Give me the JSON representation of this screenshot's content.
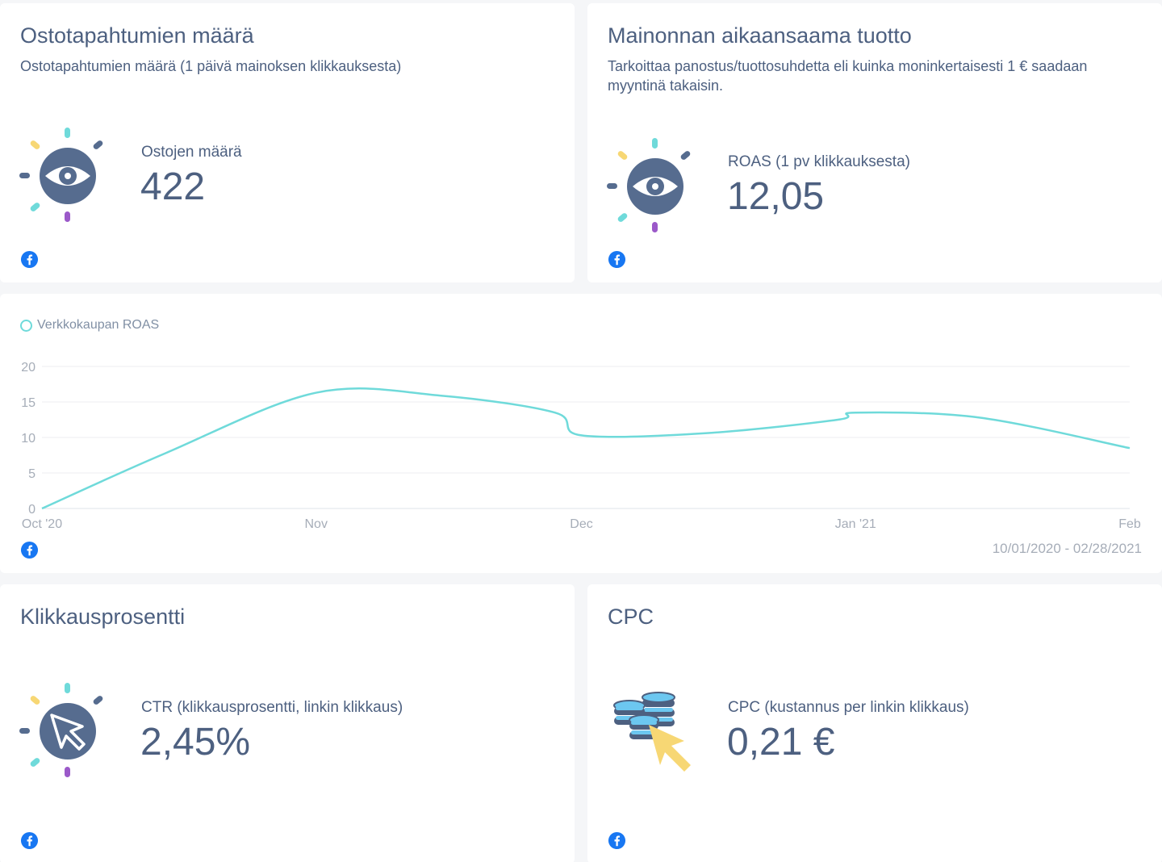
{
  "cards": {
    "purchases": {
      "title": "Ostotapahtumien määrä",
      "subtitle": "Ostotapahtumien määrä (1 päivä mainoksen klikkauksesta)",
      "metric_label": "Ostojen määrä",
      "metric_value": "422",
      "icon": "eye-icon",
      "source_icon": "facebook-icon"
    },
    "roas": {
      "title": "Mainonnan aikaansaama tuotto",
      "subtitle": "Tarkoittaa panostus/tuottosuhdetta eli kuinka moninkertaisesti 1 € saadaan myyntinä takaisin.",
      "metric_label": "ROAS (1 pv klikkauksesta)",
      "metric_value": "12,05",
      "icon": "eye-icon",
      "source_icon": "facebook-icon"
    },
    "ctr": {
      "title": "Klikkausprosentti",
      "metric_label": "CTR (klikkausprosentti, linkin klikkaus)",
      "metric_value": "2,45%",
      "icon": "cursor-click-icon",
      "source_icon": "facebook-icon"
    },
    "cpc": {
      "title": "CPC",
      "metric_label": "CPC (kustannus per linkin klikkaus)",
      "metric_value": "0,21 €",
      "icon": "coins-cursor-icon",
      "source_icon": "facebook-icon"
    }
  },
  "chart_card": {
    "date_range": "10/01/2020 - 02/28/2021",
    "source_icon": "facebook-icon"
  },
  "colors": {
    "text": "#4d6080",
    "line": "#6fdada",
    "icon_dark": "#566c8f",
    "spark_yellow": "#f7d774",
    "spark_teal": "#6fdada",
    "spark_purple": "#9b59c9",
    "facebook": "#1877f2"
  },
  "chart_data": {
    "type": "line",
    "legend": [
      "Verkkokaupan ROAS"
    ],
    "x_tick_labels": [
      "Oct '20",
      "Nov",
      "Dec",
      "Jan '21",
      "Feb"
    ],
    "y_ticks": [
      0,
      5,
      10,
      15,
      20
    ],
    "ylim": [
      0,
      20
    ],
    "grid": true,
    "legend_position": "top-left",
    "series": [
      {
        "name": "Verkkokaupan ROAS",
        "x": [
          "2020-10-01",
          "2020-10-15",
          "2020-11-01",
          "2020-11-15",
          "2020-11-28",
          "2020-12-01",
          "2020-12-15",
          "2020-12-30",
          "2021-01-01",
          "2021-01-15",
          "2021-02-01"
        ],
        "values": [
          0,
          7.8,
          16.3,
          15.9,
          13.5,
          10.3,
          10.6,
          12.5,
          13.5,
          12.8,
          8.5
        ]
      }
    ]
  }
}
